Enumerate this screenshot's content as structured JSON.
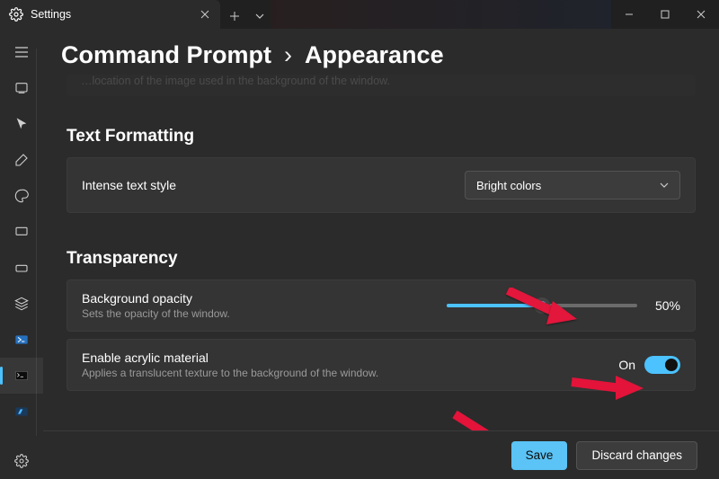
{
  "tab": {
    "title": "Settings"
  },
  "breadcrumb": {
    "seg1": "Command Prompt",
    "seg2": "Appearance",
    "sep": "›"
  },
  "partial_row": "…location of the image used in the background of the window.",
  "sections": {
    "text_formatting": {
      "title": "Text Formatting",
      "intense": {
        "label": "Intense text style",
        "value": "Bright colors"
      }
    },
    "transparency": {
      "title": "Transparency",
      "opacity": {
        "label": "Background opacity",
        "desc": "Sets the opacity of the window.",
        "value_text": "50%",
        "value_pct": 50
      },
      "acrylic": {
        "label": "Enable acrylic material",
        "desc": "Applies a translucent texture to the background of the window.",
        "state_label": "On",
        "on": true
      }
    }
  },
  "footer": {
    "save": "Save",
    "discard": "Discard changes"
  },
  "sidebar": {
    "items": [
      {
        "id": "hamburger"
      },
      {
        "id": "startup"
      },
      {
        "id": "interaction"
      },
      {
        "id": "appearance"
      },
      {
        "id": "color"
      },
      {
        "id": "rendering"
      },
      {
        "id": "actions"
      },
      {
        "id": "layers"
      },
      {
        "id": "powershell"
      },
      {
        "id": "cmd",
        "active": true
      },
      {
        "id": "azure"
      }
    ],
    "bottom": {
      "id": "settings"
    }
  }
}
